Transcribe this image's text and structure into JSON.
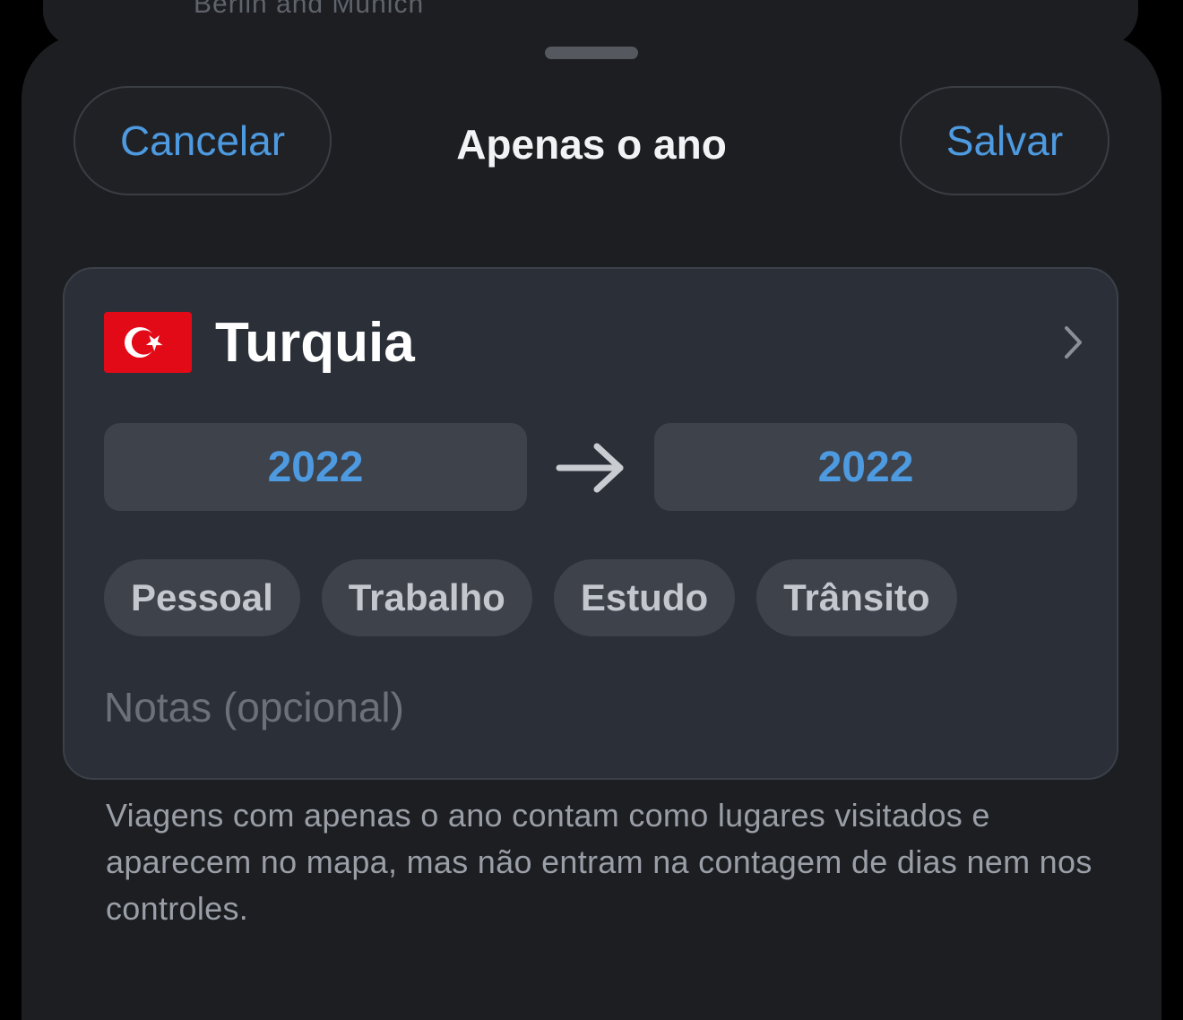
{
  "background_card": {
    "text": "Berlin and Munich"
  },
  "header": {
    "cancel_label": "Cancelar",
    "title": "Apenas o ano",
    "save_label": "Salvar"
  },
  "trip": {
    "flag_icon": "turkey-flag-icon",
    "country": "Turquia",
    "start_year": "2022",
    "end_year": "2022",
    "categories": [
      "Pessoal",
      "Trabalho",
      "Estudo",
      "Trânsito"
    ],
    "notes_placeholder": "Notas (opcional)"
  },
  "footnote": "Viagens com apenas o ano contam como lugares visitados e aparecem no mapa, mas não entram na contagem de dias nem nos controles.",
  "colors": {
    "accent": "#4e9ae0",
    "sheet_bg": "#1c1e22",
    "card_bg": "#2b3038",
    "flag_red": "#e30a17"
  }
}
